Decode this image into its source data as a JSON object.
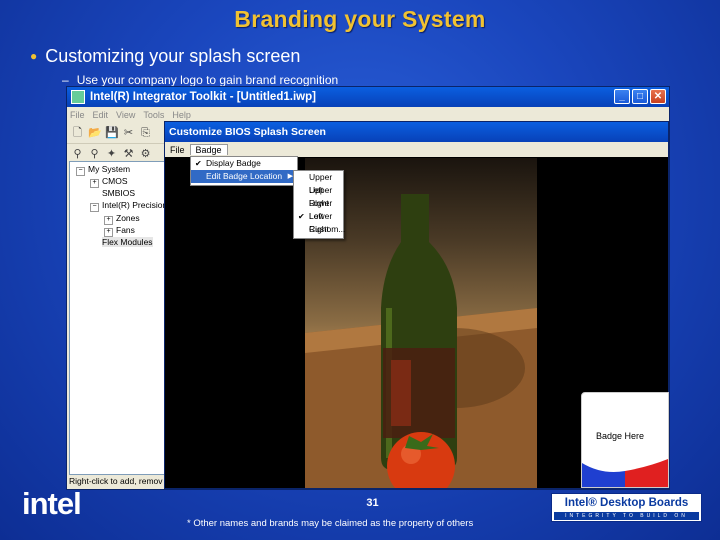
{
  "slide": {
    "title": "Branding your System",
    "bullet": "Customizing your splash screen",
    "subbullet": "Use your company logo to gain brand recognition",
    "page_number": "31",
    "footnote": "* Other names and brands may be claimed as the property of others",
    "intel_logo": "intel",
    "idb_logo_title": "Intel® Desktop Boards",
    "idb_logo_tagline": "INTEGRITY TO BUILD ON"
  },
  "app": {
    "title": "Intel(R) Integrator Toolkit - [Untitled1.iwp]",
    "menu": [
      "File",
      "Edit",
      "View",
      "Tools",
      "Help"
    ],
    "tree": [
      {
        "label": "My System",
        "expander": "−",
        "indent": 0
      },
      {
        "label": "CMOS",
        "expander": "+",
        "indent": 1
      },
      {
        "label": "SMBIOS",
        "expander": "",
        "indent": 1
      },
      {
        "label": "Intel(R) Precision",
        "expander": "−",
        "indent": 1
      },
      {
        "label": "Zones",
        "expander": "+",
        "indent": 2
      },
      {
        "label": "Fans",
        "expander": "+",
        "indent": 2
      },
      {
        "label": "Flex Modules",
        "expander": "",
        "indent": 1
      }
    ],
    "status": "Right-click to add, remov"
  },
  "splash": {
    "title": "Customize BIOS Splash Screen",
    "menu": [
      "File",
      "Badge"
    ],
    "badge_menu": [
      {
        "label": "Display Badge",
        "checked": true,
        "submenu": false
      },
      {
        "label": "Edit Badge Location",
        "checked": false,
        "submenu": true
      }
    ],
    "location_menu": [
      {
        "label": "Upper Left",
        "checked": false
      },
      {
        "label": "Upper Right",
        "checked": false
      },
      {
        "label": "Lower Left",
        "checked": false
      },
      {
        "label": "Lower Right",
        "checked": true
      },
      {
        "label": "Custom...",
        "checked": false
      }
    ],
    "badge_label": "Badge Here"
  }
}
